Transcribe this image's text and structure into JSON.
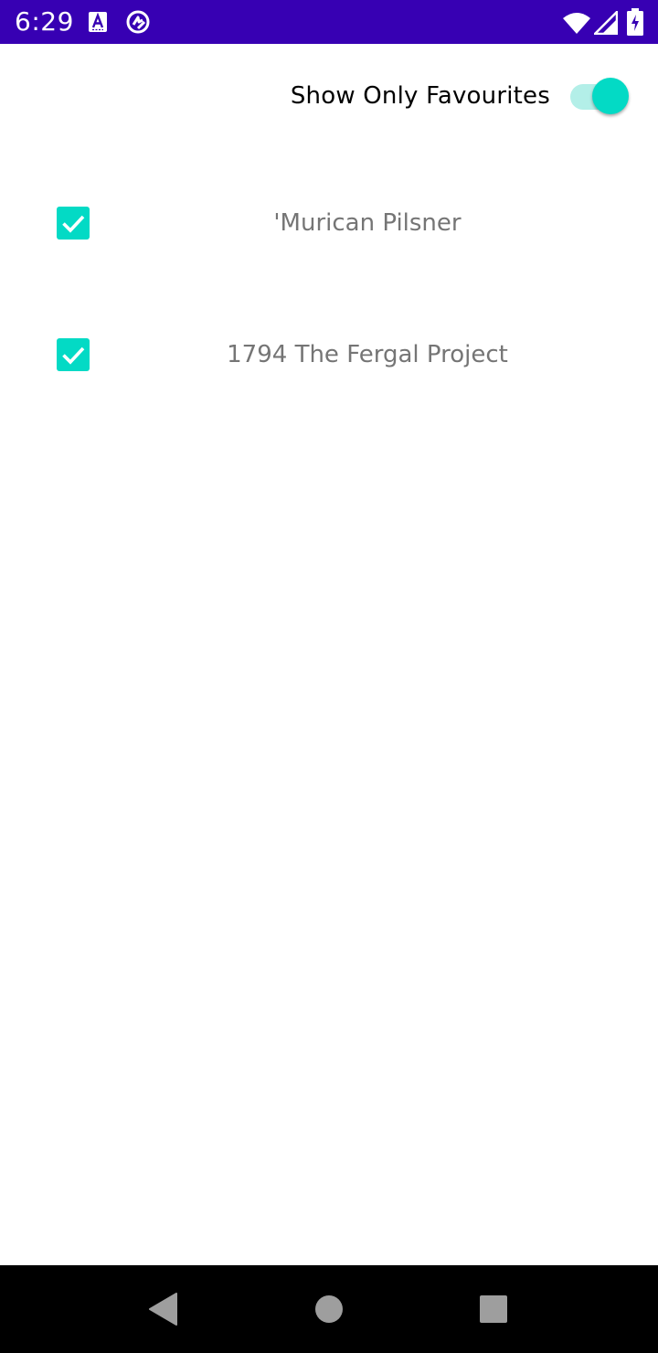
{
  "status_bar": {
    "time": "6:29",
    "background": "#3700b3",
    "icons": [
      "text-a-icon",
      "sync-icon",
      "wifi-icon",
      "signal-icon",
      "battery-charging-icon"
    ]
  },
  "favourites": {
    "label": "Show Only Favourites",
    "toggle_on": true,
    "accent_color": "#03dac5"
  },
  "beers": [
    {
      "name": "'Murican Pilsner",
      "favourite": true
    },
    {
      "name": "1794 The Fergal Project",
      "favourite": true
    }
  ],
  "navigation_bar": {
    "icons": [
      "back-icon",
      "home-icon",
      "recents-icon"
    ]
  }
}
